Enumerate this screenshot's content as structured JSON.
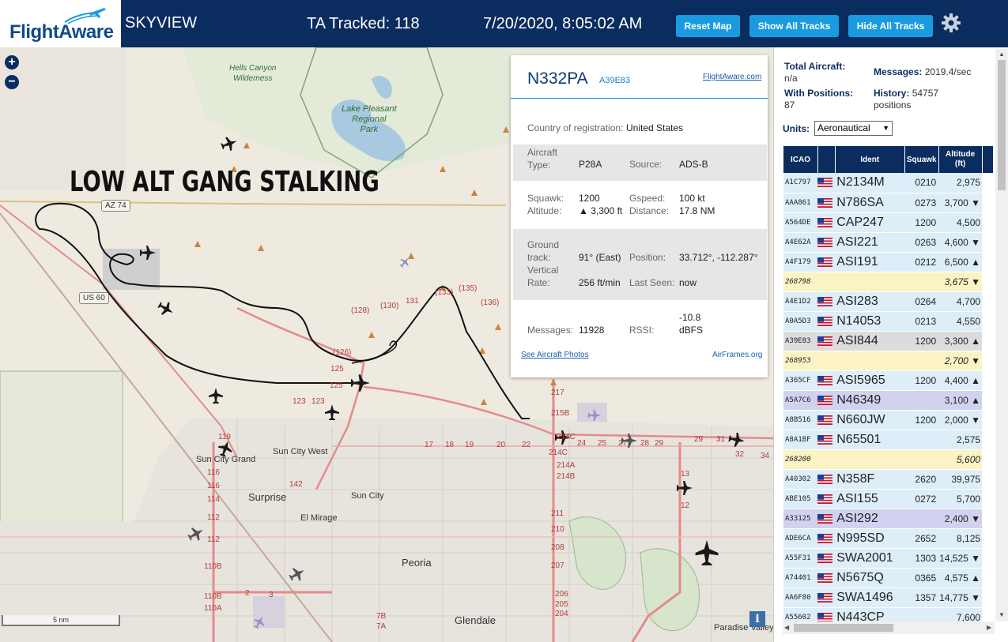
{
  "header": {
    "logo_text": "FlightAware",
    "app_name": "SKYVIEW",
    "tracked": "TA Tracked: 118",
    "datetime": "7/20/2020, 8:05:02 AM",
    "buttons": {
      "reset": "Reset Map",
      "show": "Show All Tracks",
      "hide": "Hide All Tracks"
    },
    "settings_icon": "gear-icon"
  },
  "map": {
    "annotation": "LOW ALT GANG STALKING",
    "labels": {
      "hells_canyon": "Hells Canyon\nWilderness",
      "lake_pleasant": "Lake Pleasant\nRegional\nPark",
      "sun_city_grand": "Sun City Grand",
      "sun_city_west": "Sun City West",
      "surprise": "Surprise",
      "sun_city": "Sun City",
      "el_mirage": "El Mirage",
      "peoria": "Peoria",
      "glendale": "Glendale",
      "paradise_valley": "Paradise Valley",
      "az74": "AZ 74",
      "us60": "US 60"
    },
    "road_numbers": [
      "(128)",
      "(130)",
      "131",
      "(133)",
      "(135)",
      "(136)",
      "(126)",
      "125",
      "125",
      "123",
      "123",
      "119",
      "116",
      "116",
      "114",
      "112",
      "112",
      "110B",
      "110B",
      "110A",
      "142",
      "217",
      "215B",
      "214C",
      "214C",
      "214A",
      "214B",
      "211",
      "210",
      "208",
      "207",
      "206",
      "205",
      "204",
      "17",
      "18",
      "19",
      "20",
      "22",
      "24",
      "25",
      "27",
      "28",
      "29",
      "29",
      "31",
      "32",
      "34",
      "13",
      "12",
      "2",
      "3",
      "7B",
      "7A"
    ],
    "scale": "5 nm",
    "zoom_in": "+",
    "zoom_out": "−",
    "info": "i"
  },
  "popup": {
    "registration": "N332PA",
    "hex": "A39E83",
    "flightaware_link": "FlightAware.com",
    "country_label": "Country of registration:",
    "country_value": "United States",
    "aircraft_type_label": "Aircraft\nType:",
    "aircraft_type_value": "P28A",
    "source_label": "Source:",
    "source_value": "ADS-B",
    "squawk_label": "Squawk:",
    "squawk_value": "1200",
    "altitude_label": "Altitude:",
    "altitude_value": "▲ 3,300 ft",
    "gspeed_label": "Gspeed:",
    "gspeed_value": "100 kt",
    "distance_label": "Distance:",
    "distance_value": "17.8 NM",
    "ground_track_label": "Ground\ntrack:",
    "ground_track_value": "91° (East)",
    "position_label": "Position:",
    "position_value": "33.712°, -112.287°",
    "vrate_label": "Vertical\nRate:",
    "vrate_value": "256 ft/min",
    "last_seen_label": "Last Seen:",
    "last_seen_value": "now",
    "messages_label": "Messages:",
    "messages_value": "11928",
    "rssi_label": "RSSI:",
    "rssi_value": "-10.8\ndBFS",
    "photos_link": "See Aircraft Photos",
    "airframes_link": "AirFrames.org"
  },
  "sidebar": {
    "total_aircraft_label": "Total Aircraft:",
    "total_aircraft_value": "n/a",
    "messages_label": "Messages:",
    "messages_value": "2019.4/sec",
    "with_positions_label": "With Positions:",
    "with_positions_value": "87",
    "history_label": "History:",
    "history_value": "54757\npositions",
    "units_label": "Units:",
    "units_value": "Aeronautical",
    "columns": [
      "ICAO",
      "",
      "Ident",
      "Squawk",
      "Altitude\n(ft)"
    ],
    "rows": [
      {
        "icao": "A1C797",
        "flag": true,
        "ident": "N2134M",
        "squawk": "0210",
        "alt": "2,975",
        "style": "blue"
      },
      {
        "icao": "AAA861",
        "flag": true,
        "ident": "N786SA",
        "squawk": "0273",
        "alt": "3,700 ▼",
        "style": "blue"
      },
      {
        "icao": "A564DE",
        "flag": true,
        "ident": "CAP247",
        "squawk": "1200",
        "alt": "4,500",
        "style": "blue"
      },
      {
        "icao": "A4E62A",
        "flag": true,
        "ident": "ASI221",
        "squawk": "0263",
        "alt": "4,600 ▼",
        "style": "blue"
      },
      {
        "icao": "A4F179",
        "flag": true,
        "ident": "ASI191",
        "squawk": "0212",
        "alt": "6,500 ▲",
        "style": "blue"
      },
      {
        "icao": "268798",
        "flag": false,
        "ident": "",
        "squawk": "",
        "alt": "3,675 ▼",
        "style": "yellow"
      },
      {
        "icao": "A4E1D2",
        "flag": true,
        "ident": "ASI283",
        "squawk": "0264",
        "alt": "4,700",
        "style": "blue"
      },
      {
        "icao": "A0A5D3",
        "flag": true,
        "ident": "N14053",
        "squawk": "0213",
        "alt": "4,550",
        "style": "blue"
      },
      {
        "icao": "A39E83",
        "flag": true,
        "ident": "ASI844",
        "squawk": "1200",
        "alt": "3,300 ▲",
        "style": "grey"
      },
      {
        "icao": "268953",
        "flag": false,
        "ident": "",
        "squawk": "",
        "alt": "2,700 ▼",
        "style": "yellow"
      },
      {
        "icao": "A365CF",
        "flag": true,
        "ident": "ASI5965",
        "squawk": "1200",
        "alt": "4,400 ▲",
        "style": "blue"
      },
      {
        "icao": "A5A7C6",
        "flag": true,
        "ident": "N46349",
        "squawk": "",
        "alt": "3,100 ▲",
        "style": "lav"
      },
      {
        "icao": "A8B516",
        "flag": true,
        "ident": "N660JW",
        "squawk": "1200",
        "alt": "2,000 ▼",
        "style": "blue"
      },
      {
        "icao": "A8A1BF",
        "flag": true,
        "ident": "N65501",
        "squawk": "",
        "alt": "2,575",
        "style": "blue"
      },
      {
        "icao": "268200",
        "flag": false,
        "ident": "",
        "squawk": "",
        "alt": "5,600",
        "style": "yellow"
      },
      {
        "icao": "A40302",
        "flag": true,
        "ident": "N358F",
        "squawk": "2620",
        "alt": "39,975",
        "style": "blue"
      },
      {
        "icao": "ABE105",
        "flag": true,
        "ident": "ASI155",
        "squawk": "0272",
        "alt": "5,700",
        "style": "blue"
      },
      {
        "icao": "A33125",
        "flag": true,
        "ident": "ASI292",
        "squawk": "",
        "alt": "2,400 ▼",
        "style": "lav"
      },
      {
        "icao": "ADE6CA",
        "flag": true,
        "ident": "N995SD",
        "squawk": "2652",
        "alt": "8,125",
        "style": "blue"
      },
      {
        "icao": "A55F31",
        "flag": true,
        "ident": "SWA2001",
        "squawk": "1303",
        "alt": "14,525 ▼",
        "style": "blue"
      },
      {
        "icao": "A74401",
        "flag": true,
        "ident": "N5675Q",
        "squawk": "0365",
        "alt": "4,575 ▲",
        "style": "blue"
      },
      {
        "icao": "AA6F80",
        "flag": true,
        "ident": "SWA1496",
        "squawk": "1357",
        "alt": "14,775 ▼",
        "style": "blue"
      },
      {
        "icao": "A55602",
        "flag": true,
        "ident": "N443CP",
        "squawk": "",
        "alt": "7,600",
        "style": "blue"
      }
    ]
  }
}
